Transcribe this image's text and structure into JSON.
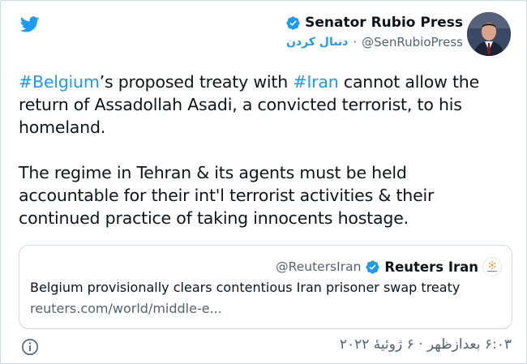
{
  "author": {
    "name": "Senator Rubio Press",
    "handle": "@SenRubioPress",
    "separator": "·",
    "follow_label": "دنبال کردن"
  },
  "tweet": {
    "hashtag1": "#Belgium",
    "text1": "’s proposed treaty with ",
    "hashtag2": "#Iran",
    "text2": " cannot allow the return of Assadollah Asadi, a convicted terrorist, to his homeland.\n\nThe regime in Tehran & its agents must be held accountable for their int'l terrorist activities & their continued practice of taking innocents hostage."
  },
  "quote": {
    "handle": "@ReutersIran",
    "name": "Reuters Iran",
    "headline": "Belgium provisionally clears contentious Iran prisoner swap treaty",
    "link": "reuters.com/world/middle-e..."
  },
  "footer": {
    "timestamp": "۶:۰۳ بعدازظهر · ۶ ژوئیهٔ ۲۰۲۲"
  },
  "colors": {
    "accent": "#1d9bf0",
    "secondary_text": "#536471",
    "border": "#cfd9de"
  },
  "icons": {
    "logo": "twitter-bird-icon",
    "verified": "verified-badge-icon",
    "info": "info-icon"
  }
}
